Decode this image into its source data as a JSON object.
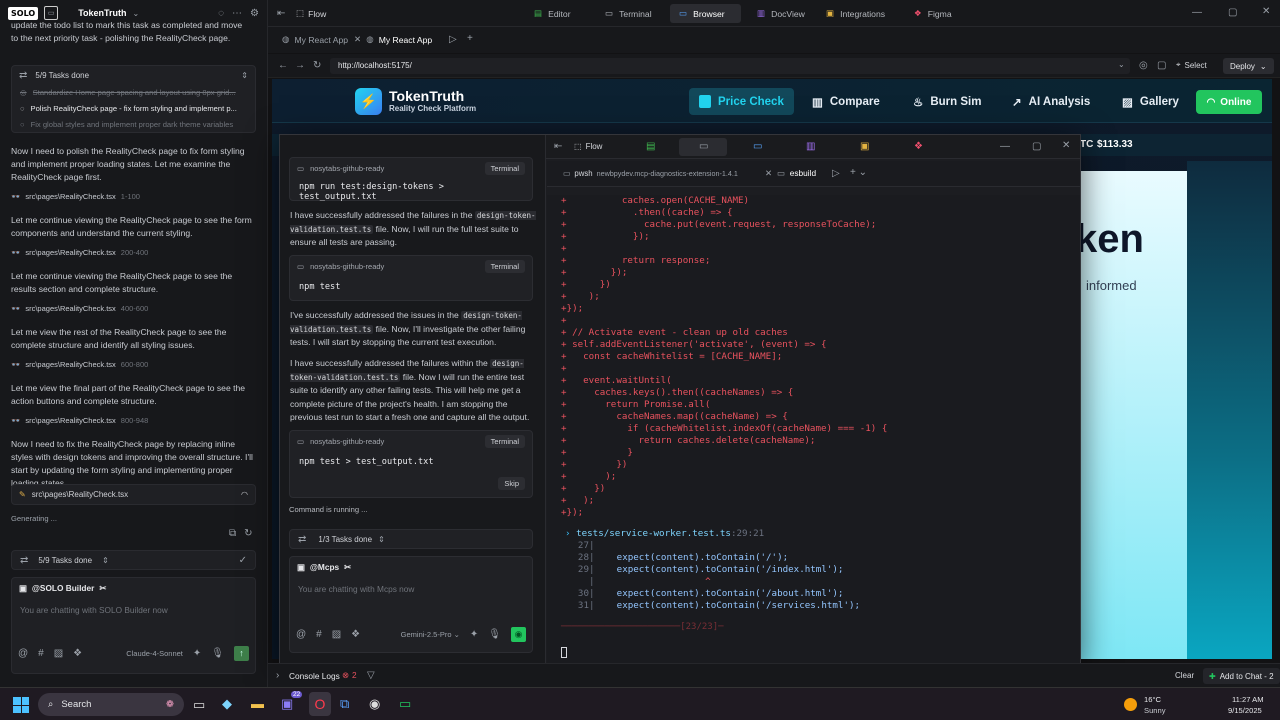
{
  "left": {
    "project_name": "TokenTruth",
    "intro_text": "update the todo list to mark this task as completed and move to the next priority task - polishing the RealityCheck page.",
    "tasks_header": "5/9 Tasks done",
    "tasks": [
      {
        "label": "Standardize Home page spacing and layout using 8px grid...",
        "state": "done"
      },
      {
        "label": "Polish RealityCheck page - fix form styling and implement p...",
        "state": "active"
      },
      {
        "label": "Fix global styles and implement proper dark theme variables",
        "state": "pending"
      }
    ],
    "messages": [
      {
        "text": "Now I need to polish the RealityCheck page to fix form styling and implement proper loading states. Let me examine the RealityCheck page first.",
        "file": "src\\pages\\RealityCheck.tsx",
        "range": "1-100"
      },
      {
        "text": "Let me continue viewing the RealityCheck page to see the form components and understand the current styling.",
        "file": "src\\pages\\RealityCheck.tsx",
        "range": "200-400"
      },
      {
        "text": "Let me continue viewing the RealityCheck page to see the results section and complete structure.",
        "file": "src\\pages\\RealityCheck.tsx",
        "range": "400-600"
      },
      {
        "text": "Let me view the rest of the RealityCheck page to see the complete structure and identify all styling issues.",
        "file": "src\\pages\\RealityCheck.tsx",
        "range": "600-800"
      },
      {
        "text": "Let me view the final part of the RealityCheck page to see the action buttons and complete structure.",
        "file": "src\\pages\\RealityCheck.tsx",
        "range": "800-948"
      }
    ],
    "final_text": "Now I need to fix the RealityCheck page by replacing inline styles with design tokens and improving the overall structure. I'll start by updating the form styling and implementing proper loading states.",
    "editing_file": "src\\pages\\RealityCheck.tsx",
    "generating": "Generating ...",
    "bottom_tasks": "5/9 Tasks done",
    "agent": "@SOLO Builder",
    "chat_placeholder": "You are chatting with SOLO Builder now",
    "model": "Claude-4-Sonnet"
  },
  "topbar": {
    "flow": "Flow",
    "tabs": [
      "Editor",
      "Terminal",
      "Browser",
      "DocView",
      "Integrations",
      "Figma"
    ]
  },
  "browser": {
    "tabs": [
      "My React App",
      "My React App"
    ],
    "url": "http://localhost:5175/",
    "select_label": "Select",
    "deploy_label": "Deploy"
  },
  "site": {
    "brand": "TokenTruth",
    "tagline": "Reality Check Platform",
    "nav": [
      "Price Check",
      "Compare",
      "Burn Sim",
      "AI Analysis",
      "Gallery"
    ],
    "online": "Online",
    "ticker_symbol": "TC",
    "ticker_price": "$113.33",
    "hero_fragment": "ken",
    "hero_sub": "informed"
  },
  "termwin": {
    "title": "nosytabs-github-ready",
    "flow": "Flow",
    "cmd_source": "nosytabs-github-ready",
    "terminal_label": "Terminal",
    "cmds": [
      "npm run test:design-tokens > test_output.txt",
      "npm test",
      "npm test > test_output.txt"
    ],
    "p1_a": "I have successfully addressed the failures in the",
    "p1_code": "design-token-validation.test.ts",
    "p1_b": "file. Now, I will run the full test suite to ensure all tests are passing.",
    "p2_a": "I've successfully addressed the issues in the",
    "p2_code": "design-token-validation.test.ts",
    "p2_b": "file. Now, I'll investigate the other failing tests. I will start by stopping the current test execution.",
    "p3_a": "I have successfully addressed the failures within the",
    "p3_code": "design-token-validation.test.ts",
    "p3_b": "file. Now I will run the entire test suite to identify any other failing tests. This will help me get a complete picture of the project's health. I am stopping the previous test run to start a fresh one and capture all the output.",
    "skip": "Skip",
    "running": "Command is running ...",
    "tasks": "1/3 Tasks done",
    "agent": "@Mcps",
    "placeholder": "You are chatting with Mcps now",
    "model": "Gemini-2.5-Pro",
    "term_tabs": [
      "pwsh",
      "newbpydev.mcp-diagnostics-extension-1.4.1",
      "esbuild"
    ],
    "code_lines": [
      "+          caches.open(CACHE_NAME)",
      "+            .then((cache) => {",
      "+              cache.put(event.request, responseToCache);",
      "+            });",
      "+",
      "+          return response;",
      "+        });",
      "+      })",
      "+    );",
      "+});",
      "+",
      "+ // Activate event - clean up old caches",
      "+ self.addEventListener('activate', (event) => {",
      "+   const cacheWhitelist = [CACHE_NAME];",
      "+",
      "+   event.waitUntil(",
      "+     caches.keys().then((cacheNames) => {",
      "+       return Promise.all(",
      "+         cacheNames.map((cacheName) => {",
      "+           if (cacheWhitelist.indexOf(cacheName) === -1) {",
      "+             return caches.delete(cacheName);",
      "+           }",
      "+         })",
      "+       );",
      "+     })",
      "+   );",
      "+});"
    ],
    "test_file": "tests/service-worker.test.ts",
    "test_loc": ":29:21",
    "test_lines": [
      {
        "n": "27",
        "code": ""
      },
      {
        "n": "28",
        "code": "    expect(content).toContain('/');"
      },
      {
        "n": "29",
        "code": "    expect(content).toContain('/index.html');"
      },
      {
        "n": "",
        "code": "                    ^"
      },
      {
        "n": "30",
        "code": "    expect(content).toContain('/about.html');"
      },
      {
        "n": "31",
        "code": "    expect(content).toContain('/services.html');"
      }
    ],
    "summary": "[23/23]"
  },
  "console": {
    "label": "Console Logs",
    "count": "2",
    "clear": "Clear",
    "add_chat": "Add to Chat - 2"
  },
  "taskbar": {
    "search": "Search",
    "weather_temp": "16°C",
    "weather_desc": "Sunny",
    "time": "11:27 AM",
    "date": "9/15/2025",
    "badge": "22"
  },
  "colors": {
    "accent_green": "#22c55e",
    "accent_cyan": "#22d3ee",
    "diff_red": "#e8525e"
  }
}
